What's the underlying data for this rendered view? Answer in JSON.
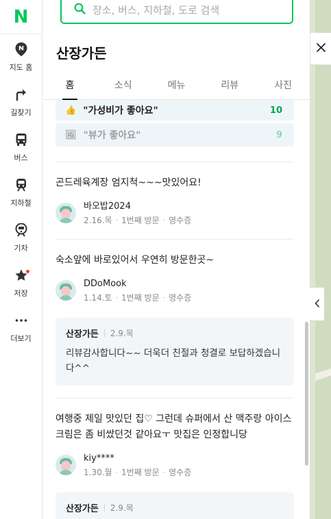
{
  "logo": "N",
  "rail": [
    {
      "label": "지도 홈",
      "icon": "map-pin-icon"
    },
    {
      "label": "길찾기",
      "icon": "directions-icon"
    },
    {
      "label": "버스",
      "icon": "bus-icon"
    },
    {
      "label": "지하철",
      "icon": "subway-icon"
    },
    {
      "label": "기차",
      "icon": "train-icon"
    },
    {
      "label": "저장",
      "icon": "star-icon"
    },
    {
      "label": "더보기",
      "icon": "more-icon"
    }
  ],
  "search": {
    "placeholder": "장소, 버스, 지하철, 도로 검색"
  },
  "place": {
    "title": "산장가든"
  },
  "tabs": [
    "홈",
    "소식",
    "메뉴",
    "리뷰",
    "사진"
  ],
  "active_tab": "홈",
  "keywords": [
    {
      "emoji": "👍",
      "label": "\"가성비가 좋아요\"",
      "count": "10"
    },
    {
      "emoji": "🖼",
      "label": "\"뷰가 좋아요\"",
      "count": "9"
    }
  ],
  "reviews": [
    {
      "text": "곤드레육계장 엄지척~~~맛있어요!",
      "author": "바오밥2024",
      "date": "2.16.목",
      "visit": "1번째 방문",
      "proof": "영수증"
    },
    {
      "text": "숙소앞에 바로있어서 우연히 방문한곳~",
      "author": "DDoMook",
      "date": "1.14.토",
      "visit": "1번째 방문",
      "proof": "영수증",
      "reply": {
        "owner": "산장가든",
        "date": "2.9.목",
        "text": "리뷰감사합니다~~ 더욱더 친절과 청결로 보답하겠습니다^^"
      }
    },
    {
      "text": "여행중 제일 맛있던 집♡ 그런데 슈퍼에서 산 맥주랑 아이스크림은 좀 비쌌던것 같아요ㅜ 맛집은 인정합니당",
      "author": "kiy****",
      "date": "1.30.월",
      "visit": "1번째 방문",
      "proof": "영수증",
      "reply": {
        "owner": "산장가든",
        "date": "2.9.목",
        "text": ""
      }
    }
  ],
  "colors": {
    "brand": "#03c75a",
    "keyword_bg": "#eef5f8",
    "reply_bg": "#f3f6f8",
    "map": "#cfdcbf"
  }
}
